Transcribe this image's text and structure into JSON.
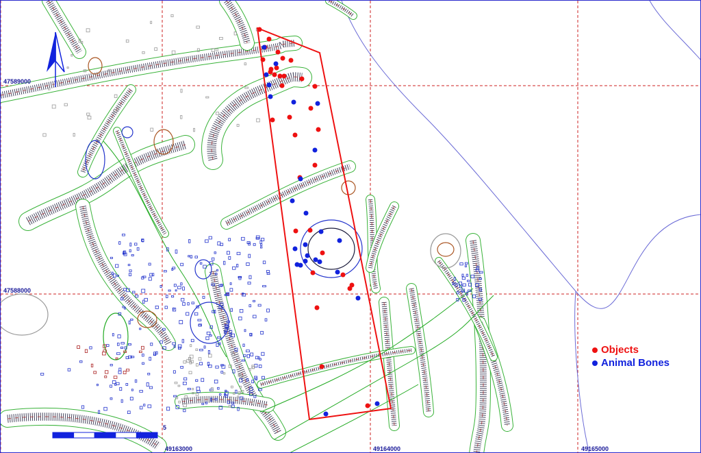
{
  "map": {
    "colors": {
      "grid": "#cc2222",
      "features": "#22aa22",
      "hatch_dark": "#1a1a3a",
      "hatch_red": "#aa2222",
      "outline_blue": "#2233cc",
      "outline_brown": "#aa5522",
      "stone": "#999999",
      "boundary": "#6a6ad6",
      "trench": "#ee1111",
      "objects": "#ee1111",
      "animal_bones": "#1122dd",
      "coord_text": "#1a1a99"
    },
    "coords": {
      "northing_upper": "47589000",
      "northing_lower": "47588000",
      "easting_left": "49163000",
      "easting_mid": "49164000",
      "easting_right": "49165000"
    },
    "north_arrow": {
      "symbol": "north-arrow"
    },
    "scale_bar": {
      "label": "5"
    },
    "legend": {
      "objects_label": "Objects",
      "animal_bones_label": "Animal Bones"
    }
  }
}
